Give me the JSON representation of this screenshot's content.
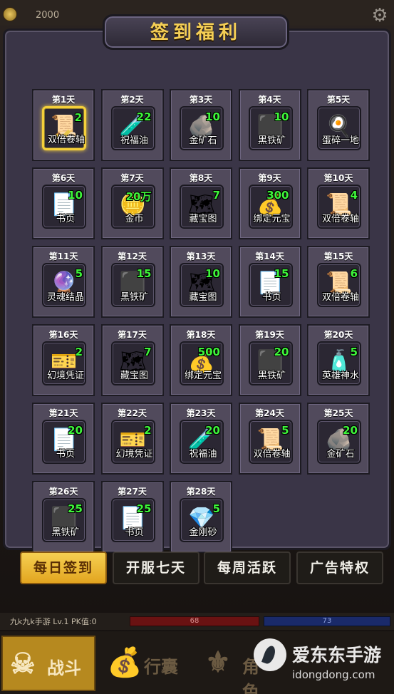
{
  "topbar": {
    "coin_count": "2000"
  },
  "panel": {
    "title": "签到福利"
  },
  "days": [
    {
      "day": "第1天",
      "name": "双倍卷轴",
      "qty": "2",
      "icon": "scroll-icon",
      "glyph": "📜",
      "active": true
    },
    {
      "day": "第2天",
      "name": "祝福油",
      "qty": "22",
      "icon": "potion-icon",
      "glyph": "🧪"
    },
    {
      "day": "第3天",
      "name": "金矿石",
      "qty": "10",
      "icon": "gold-ore-icon",
      "glyph": "🪨"
    },
    {
      "day": "第4天",
      "name": "黑铁矿",
      "qty": "10",
      "icon": "iron-ore-icon",
      "glyph": "⬛"
    },
    {
      "day": "第5天",
      "name": "蛋碎一地",
      "qty": "",
      "icon": "egg-icon",
      "glyph": "🍳"
    },
    {
      "day": "第6天",
      "name": "书页",
      "qty": "10",
      "icon": "page-icon",
      "glyph": "📄"
    },
    {
      "day": "第7天",
      "name": "金币",
      "qty": "20万",
      "icon": "coins-icon",
      "glyph": "🪙"
    },
    {
      "day": "第8天",
      "name": "藏宝图",
      "qty": "7",
      "icon": "treasure-map-icon",
      "glyph": "🗺"
    },
    {
      "day": "第9天",
      "name": "绑定元宝",
      "qty": "300",
      "icon": "ingot-icon",
      "glyph": "💰"
    },
    {
      "day": "第10天",
      "name": "双倍卷轴",
      "qty": "4",
      "icon": "scroll-icon",
      "glyph": "📜"
    },
    {
      "day": "第11天",
      "name": "灵魂结晶",
      "qty": "5",
      "icon": "soul-crystal-icon",
      "glyph": "🔮"
    },
    {
      "day": "第12天",
      "name": "黑铁矿",
      "qty": "15",
      "icon": "iron-ore-icon",
      "glyph": "⬛"
    },
    {
      "day": "第13天",
      "name": "藏宝图",
      "qty": "10",
      "icon": "treasure-map-icon",
      "glyph": "🗺"
    },
    {
      "day": "第14天",
      "name": "书页",
      "qty": "15",
      "icon": "page-icon",
      "glyph": "📄"
    },
    {
      "day": "第15天",
      "name": "双倍卷轴",
      "qty": "6",
      "icon": "scroll-icon",
      "glyph": "📜"
    },
    {
      "day": "第16天",
      "name": "幻境凭证",
      "qty": "2",
      "icon": "voucher-icon",
      "glyph": "🎫"
    },
    {
      "day": "第17天",
      "name": "藏宝图",
      "qty": "7",
      "icon": "treasure-map-icon",
      "glyph": "🗺"
    },
    {
      "day": "第18天",
      "name": "绑定元宝",
      "qty": "500",
      "icon": "ingot-icon",
      "glyph": "💰"
    },
    {
      "day": "第19天",
      "name": "黑铁矿",
      "qty": "20",
      "icon": "iron-ore-icon",
      "glyph": "⬛"
    },
    {
      "day": "第20天",
      "name": "英雄神水",
      "qty": "5",
      "icon": "hero-water-icon",
      "glyph": "🧴"
    },
    {
      "day": "第21天",
      "name": "书页",
      "qty": "20",
      "icon": "page-icon",
      "glyph": "📄"
    },
    {
      "day": "第22天",
      "name": "幻境凭证",
      "qty": "2",
      "icon": "voucher-icon",
      "glyph": "🎫"
    },
    {
      "day": "第23天",
      "name": "祝福油",
      "qty": "20",
      "icon": "potion-icon",
      "glyph": "🧪"
    },
    {
      "day": "第24天",
      "name": "双倍卷轴",
      "qty": "5",
      "icon": "scroll-icon",
      "glyph": "📜"
    },
    {
      "day": "第25天",
      "name": "金矿石",
      "qty": "20",
      "icon": "gold-ore-icon",
      "glyph": "🪨"
    },
    {
      "day": "第26天",
      "name": "黑铁矿",
      "qty": "25",
      "icon": "iron-ore-icon",
      "glyph": "⬛"
    },
    {
      "day": "第27天",
      "name": "书页",
      "qty": "25",
      "icon": "page-icon",
      "glyph": "📄"
    },
    {
      "day": "第28天",
      "name": "金刚砂",
      "qty": "5",
      "icon": "emery-icon",
      "glyph": "💎"
    }
  ],
  "tabs": [
    {
      "label": "每日签到",
      "active": true
    },
    {
      "label": "开服七天",
      "active": false
    },
    {
      "label": "每周活跃",
      "active": false
    },
    {
      "label": "广告特权",
      "active": false
    }
  ],
  "status": {
    "player": "九k九k手游  Lv.1  PK值:0",
    "hp": "68",
    "mp": "73"
  },
  "bottom_nav": [
    {
      "label": "战斗",
      "icon": "sword-icon",
      "active": true
    },
    {
      "label": "行囊",
      "icon": "bag-icon",
      "active": false
    },
    {
      "label": "角色",
      "icon": "character-icon",
      "active": false
    }
  ],
  "watermark": {
    "brand": "爱东东手游",
    "url": "idongdong.com"
  },
  "colors": {
    "accent": "#f5cf55",
    "qty_green": "#3ef53a",
    "panel_bg": "#3a3547",
    "tab_active": "#f0bd38"
  }
}
